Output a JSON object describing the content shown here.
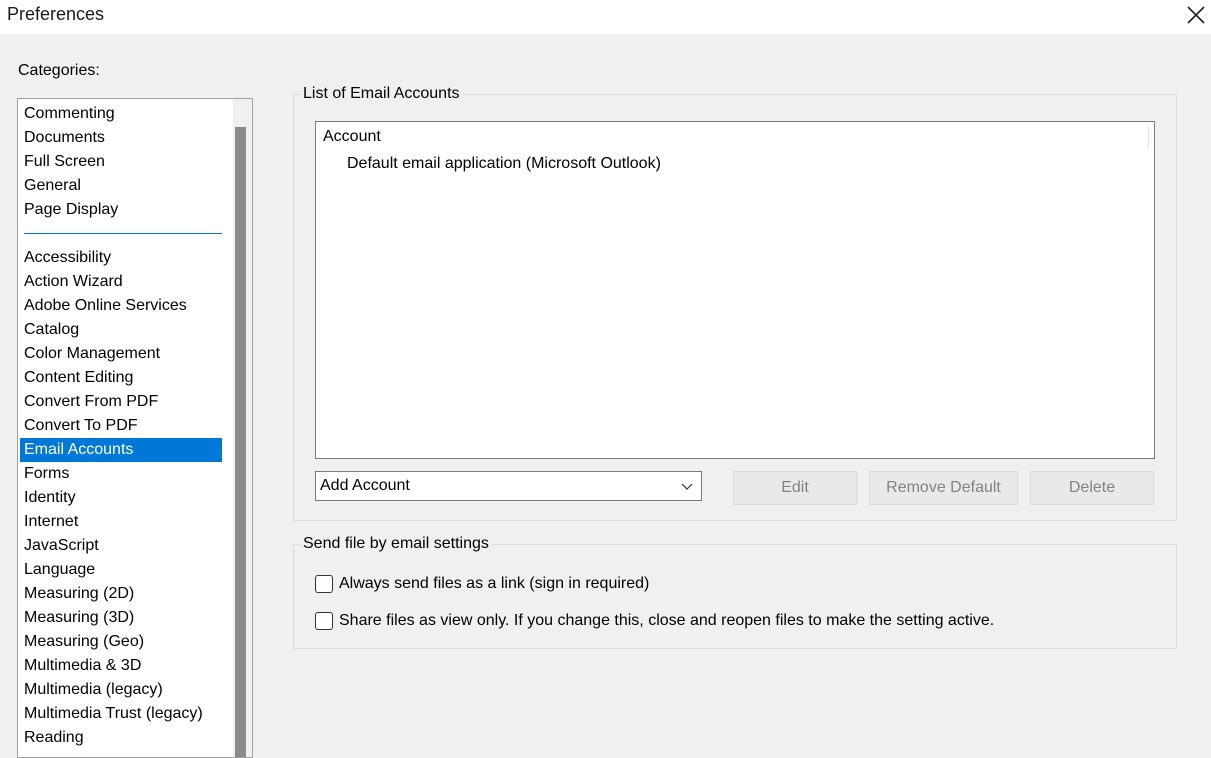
{
  "window": {
    "title": "Preferences"
  },
  "categories": {
    "label": "Categories:",
    "items_top": [
      "Commenting",
      "Documents",
      "Full Screen",
      "General",
      "Page Display"
    ],
    "items_bottom": [
      "Accessibility",
      "Action Wizard",
      "Adobe Online Services",
      "Catalog",
      "Color Management",
      "Content Editing",
      "Convert From PDF",
      "Convert To PDF",
      "Email Accounts",
      "Forms",
      "Identity",
      "Internet",
      "JavaScript",
      "Language",
      "Measuring (2D)",
      "Measuring (3D)",
      "Measuring (Geo)",
      "Multimedia & 3D",
      "Multimedia (legacy)",
      "Multimedia Trust (legacy)",
      "Reading"
    ],
    "selected": "Email Accounts"
  },
  "email_accounts": {
    "group_title": "List of Email Accounts",
    "column_header": "Account",
    "rows": [
      "Default email application (Microsoft Outlook)"
    ],
    "add_account_value": "Add Account",
    "edit_label": "Edit",
    "remove_default_label": "Remove Default",
    "delete_label": "Delete"
  },
  "send_settings": {
    "group_title": "Send file by email settings",
    "option_link": "Always send files as a link (sign in required)",
    "option_view_only": "Share files as view only. If you change this, close and reopen files to make the setting active.",
    "option_link_checked": false,
    "option_view_only_checked": false
  },
  "colors": {
    "selection": "#0078d7",
    "background": "#f0f0f0"
  },
  "icons": {
    "close": "close-icon",
    "dropdown": "chevron-down-icon"
  }
}
